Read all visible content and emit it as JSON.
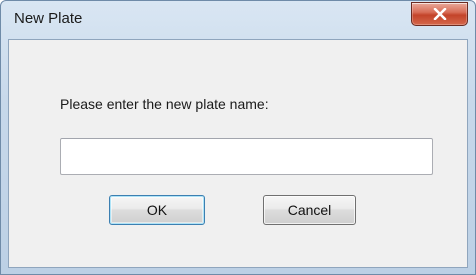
{
  "window": {
    "title": "New Plate",
    "close_icon": "close-icon",
    "accent_close": "#c3442a"
  },
  "dialog": {
    "prompt": "Please enter the new plate name:",
    "input_value": "",
    "input_placeholder": "",
    "ok_label": "OK",
    "cancel_label": "Cancel"
  }
}
